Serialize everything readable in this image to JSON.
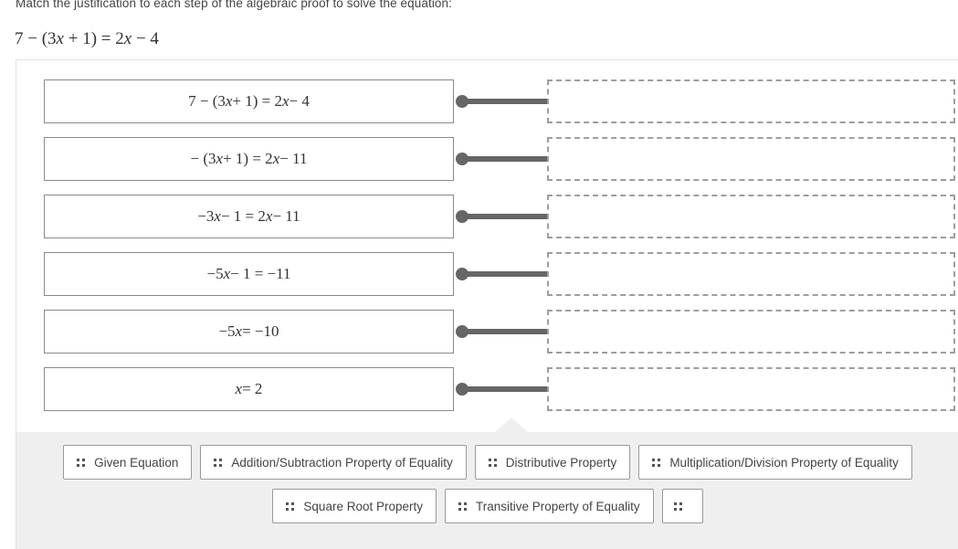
{
  "prompt": {
    "instruction": "Match the justification to each step of the algebraic proof to solve the equation:",
    "equation": "7 − (3x + 1) = 2x − 4"
  },
  "match": {
    "rows": [
      {
        "equation": "7 − (3x + 1) = 2x − 4",
        "answer": ""
      },
      {
        "equation": "− (3x + 1) = 2x − 11",
        "answer": ""
      },
      {
        "equation": "−3x − 1 = 2x − 11",
        "answer": ""
      },
      {
        "equation": "−5x − 1 = −11",
        "answer": ""
      },
      {
        "equation": "−5x = −10",
        "answer": ""
      },
      {
        "equation": "x = 2",
        "answer": ""
      }
    ]
  },
  "answer_bank": {
    "row1": [
      {
        "label": "Given Equation",
        "handle": "drag-handle-icon"
      },
      {
        "label": "Addition/Subtraction Property of Equality",
        "handle": "drag-handle-icon"
      },
      {
        "label": "Distributive Property",
        "handle": "drag-handle-icon"
      },
      {
        "label": "Multiplication/Division Property of Equality",
        "handle": "drag-handle-icon"
      }
    ],
    "row2": [
      {
        "label": "Square Root Property",
        "handle": "drag-handle-icon"
      },
      {
        "label": "Transitive Property of Equality",
        "handle": "drag-handle-icon"
      },
      {
        "label": "",
        "handle": "drag-handle-icon"
      }
    ]
  },
  "colors": {
    "bank_background": "#efefef",
    "connector": "#666666",
    "drop_zone_border": "#9e9e9e",
    "equation_border": "#8a8a8a",
    "text": "#444444"
  }
}
